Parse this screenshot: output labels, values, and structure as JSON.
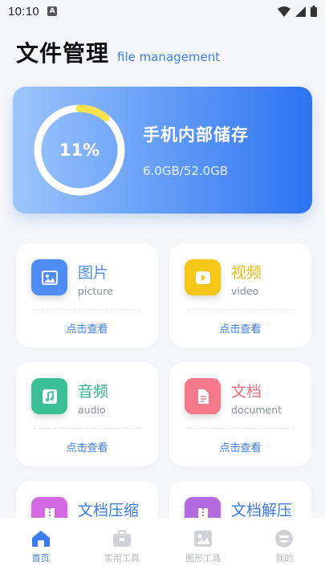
{
  "status_bar": {
    "time": "10:10"
  },
  "header": {
    "title": "文件管理",
    "subtitle": "file management"
  },
  "storage": {
    "percent_label": "11%",
    "used_fraction": 0.11,
    "title": "手机内部储存",
    "usage": "6.0GB/52.0GB"
  },
  "categories": [
    {
      "name": "图片",
      "en": "picture",
      "action": "点击查看",
      "color": "#4f8df5",
      "name_color": "#4f8df5",
      "icon": "image-icon"
    },
    {
      "name": "视频",
      "en": "video",
      "action": "点击查看",
      "color": "#f5c518",
      "name_color": "#e7b911",
      "icon": "play-icon"
    },
    {
      "name": "音频",
      "en": "audio",
      "action": "点击查看",
      "color": "#3bbf94",
      "name_color": "#34b48a",
      "icon": "music-icon"
    },
    {
      "name": "文档",
      "en": "document",
      "action": "点击查看",
      "color": "#f47a8b",
      "name_color": "#f16f82",
      "icon": "document-icon"
    },
    {
      "name": "文档压缩",
      "en": "",
      "action": "",
      "color": "#d469e2",
      "name_color": "#3c7cf0",
      "icon": "zip-icon"
    },
    {
      "name": "文档解压",
      "en": "",
      "action": "",
      "color": "#b46be0",
      "name_color": "#3c7cf0",
      "icon": "unzip-icon"
    }
  ],
  "tabs": [
    {
      "label": "首页",
      "icon": "home-icon",
      "active": true
    },
    {
      "label": "实用工具",
      "icon": "toolbox-icon",
      "active": false
    },
    {
      "label": "图形工具",
      "icon": "image-tool-icon",
      "active": false
    },
    {
      "label": "我的",
      "icon": "profile-icon",
      "active": false
    }
  ]
}
